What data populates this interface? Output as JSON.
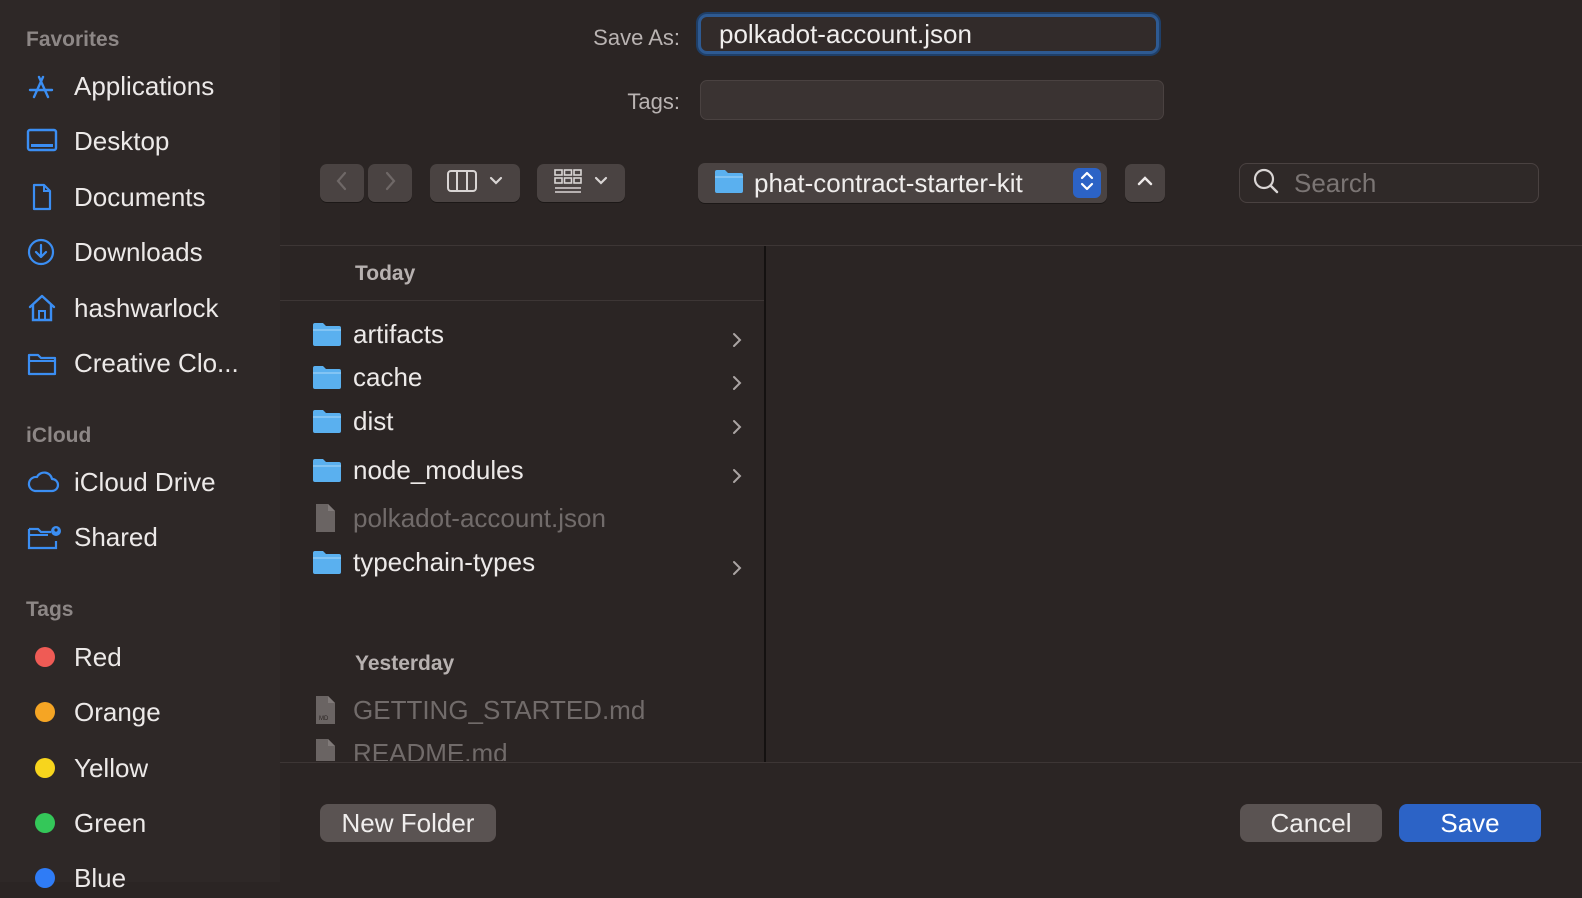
{
  "sidebar": {
    "favorites_title": "Favorites",
    "favorites": [
      {
        "label": "Applications",
        "icon": "applications-icon"
      },
      {
        "label": "Desktop",
        "icon": "desktop-icon"
      },
      {
        "label": "Documents",
        "icon": "document-icon"
      },
      {
        "label": "Downloads",
        "icon": "download-icon"
      },
      {
        "label": "hashwarlock",
        "icon": "home-icon"
      },
      {
        "label": "Creative Clo...",
        "icon": "folder-icon"
      }
    ],
    "icloud_title": "iCloud",
    "icloud": [
      {
        "label": "iCloud Drive",
        "icon": "cloud-icon"
      },
      {
        "label": "Shared",
        "icon": "shared-folder-icon"
      }
    ],
    "tags_title": "Tags",
    "tags": [
      {
        "label": "Red",
        "color": "#ef5b55"
      },
      {
        "label": "Orange",
        "color": "#f5a524"
      },
      {
        "label": "Yellow",
        "color": "#f7d51d"
      },
      {
        "label": "Green",
        "color": "#34c759"
      },
      {
        "label": "Blue",
        "color": "#2f7cf6"
      }
    ]
  },
  "form": {
    "save_as_label": "Save As:",
    "save_as_value": "polkadot-account.json",
    "tags_label": "Tags:",
    "tags_value": ""
  },
  "toolbar": {
    "location": "phat-contract-starter-kit",
    "search_placeholder": "Search"
  },
  "browser": {
    "groups": [
      {
        "title": "Today",
        "items": [
          {
            "name": "artifacts",
            "kind": "folder",
            "enabled": true
          },
          {
            "name": "cache",
            "kind": "folder",
            "enabled": true
          },
          {
            "name": "dist",
            "kind": "folder",
            "enabled": true
          },
          {
            "name": "node_modules",
            "kind": "folder",
            "enabled": true
          },
          {
            "name": "polkadot-account.json",
            "kind": "file",
            "enabled": false
          },
          {
            "name": "typechain-types",
            "kind": "folder",
            "enabled": true
          }
        ]
      },
      {
        "title": "Yesterday",
        "items": [
          {
            "name": "GETTING_STARTED.md",
            "kind": "file",
            "enabled": false
          },
          {
            "name": "README.md",
            "kind": "file",
            "enabled": false
          }
        ]
      }
    ]
  },
  "footer": {
    "new_folder": "New Folder",
    "cancel": "Cancel",
    "save": "Save"
  },
  "colors": {
    "accent": "#2c63c6",
    "sidebar_icon": "#3b8ef3",
    "folder": "#5ab0ef"
  }
}
